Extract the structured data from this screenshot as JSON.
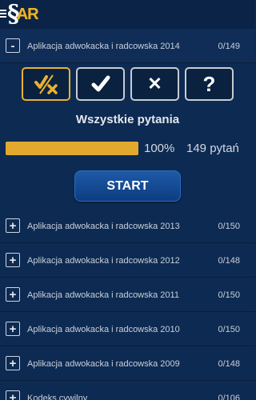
{
  "header": {
    "logo_s": "§",
    "logo_ar": "AR"
  },
  "expanded": {
    "toggle": "-",
    "label": "Aplikacja adwokacka i radcowska 2014",
    "count": "0/149"
  },
  "filters": [
    "all-questions",
    "correct",
    "wrong",
    "unanswered"
  ],
  "filter_glyphs": {
    "wrong": "✕",
    "unanswered": "?"
  },
  "selection": {
    "title": "Wszystkie pytania",
    "progress": 1.0,
    "percent_label": "100%",
    "question_count": "149 pytań"
  },
  "start_label": "START",
  "items": [
    {
      "toggle": "+",
      "label": "Aplikacja adwokacka i radcowska 2013",
      "count": "0/150"
    },
    {
      "toggle": "+",
      "label": "Aplikacja adwokacka i radcowska 2012",
      "count": "0/148"
    },
    {
      "toggle": "+",
      "label": "Aplikacja adwokacka i radcowska 2011",
      "count": "0/150"
    },
    {
      "toggle": "+",
      "label": "Aplikacja adwokacka i radcowska 2010",
      "count": "0/150"
    },
    {
      "toggle": "+",
      "label": "Aplikacja adwokacka i radcowska 2009",
      "count": "0/148"
    },
    {
      "toggle": "+",
      "label": "Kodeks cywilny",
      "count": "0/106"
    }
  ],
  "colors": {
    "accent": "#e2a92e",
    "background": "#0d2a52",
    "button": "#1e5aa8"
  }
}
